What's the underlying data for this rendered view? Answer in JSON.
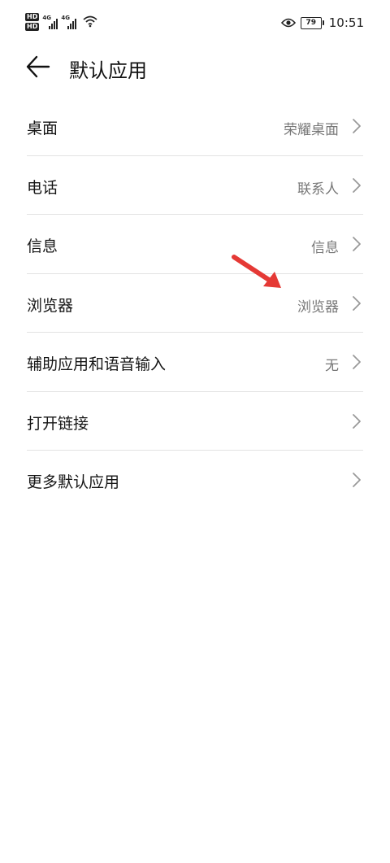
{
  "status_bar": {
    "hd_badge_1": "HD",
    "hd_badge_2": "HD",
    "network_1": "4G",
    "network_2": "4G",
    "battery": "79",
    "time": "10:51"
  },
  "header": {
    "title": "默认应用"
  },
  "items": [
    {
      "label": "桌面",
      "value": "荣耀桌面"
    },
    {
      "label": "电话",
      "value": "联系人"
    },
    {
      "label": "信息",
      "value": "信息"
    },
    {
      "label": "浏览器",
      "value": "浏览器"
    },
    {
      "label": "辅助应用和语音输入",
      "value": "无"
    },
    {
      "label": "打开链接",
      "value": ""
    },
    {
      "label": "更多默认应用",
      "value": ""
    }
  ],
  "colors": {
    "annotation_arrow": "#e53935",
    "divider": "#e3e3e3",
    "secondary_text": "#777777"
  }
}
